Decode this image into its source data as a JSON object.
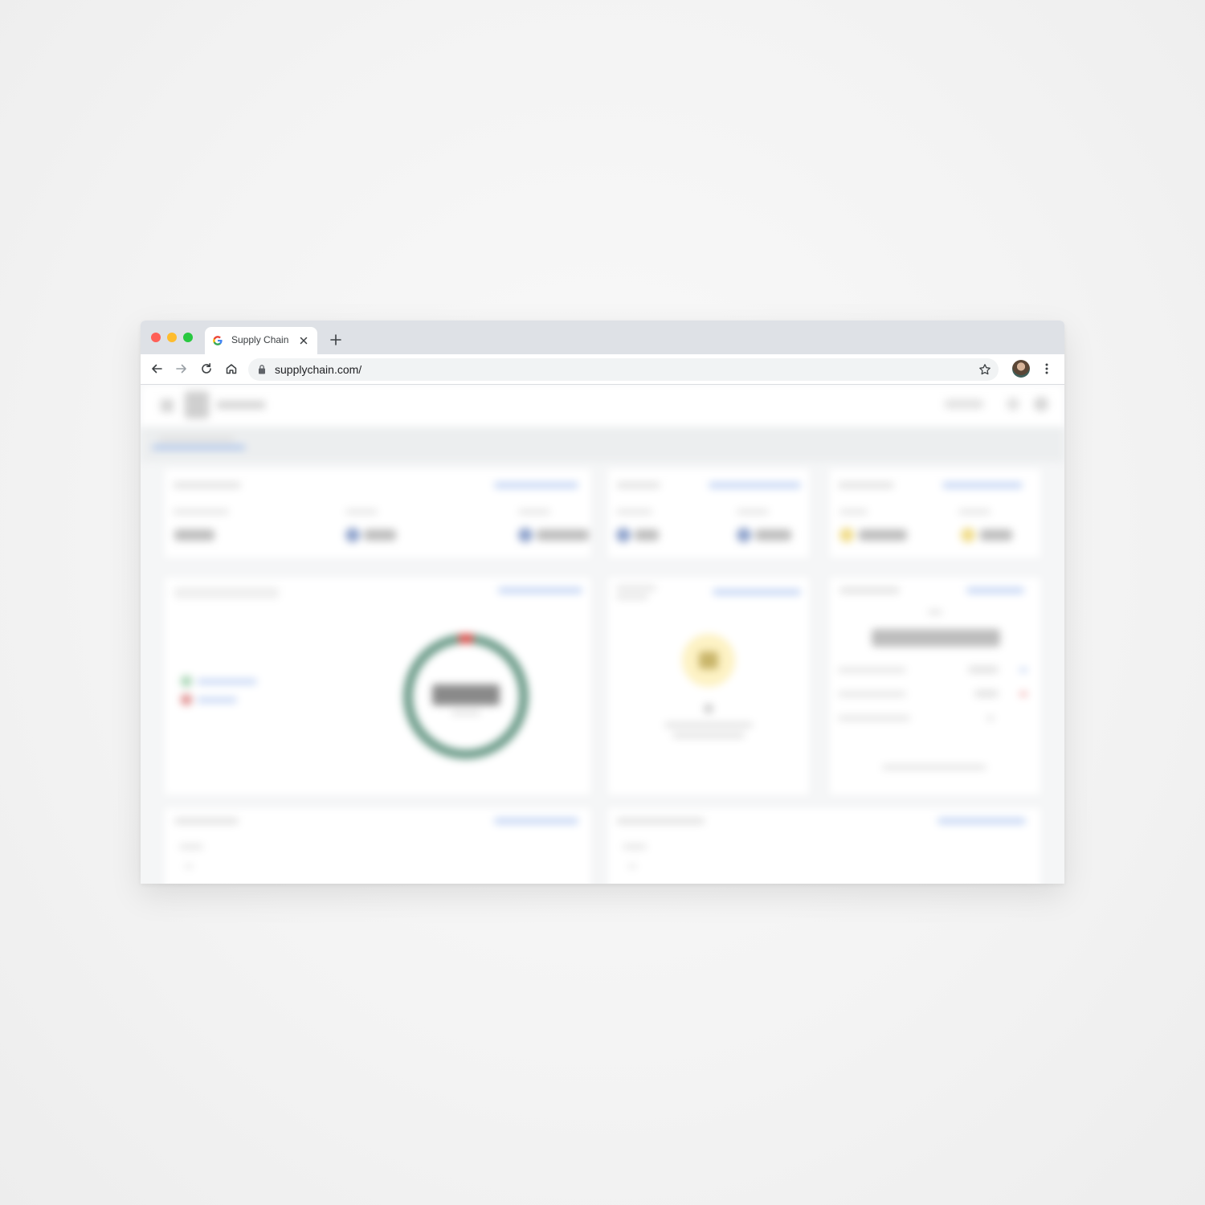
{
  "browser": {
    "tab": {
      "title": "Supply Chain",
      "favicon": "google-g-icon"
    },
    "address_bar": {
      "url": "supplychain.com/"
    },
    "icons": [
      "back-arrow-icon",
      "forward-arrow-icon",
      "reload-icon",
      "home-icon",
      "lock-icon",
      "bookmark-star-icon",
      "more-vert-icon"
    ]
  },
  "colors": {
    "tab_strip": "#dee1e6",
    "omnibox": "#f1f3f4",
    "ring": "#6d9c8a",
    "accent_blue": "#8fb2ea",
    "alert_red": "#d9534f",
    "warning_yellow": "#f4d35e"
  },
  "dashboard": {
    "ring_chart": {
      "primary_fraction": 0.96
    }
  }
}
